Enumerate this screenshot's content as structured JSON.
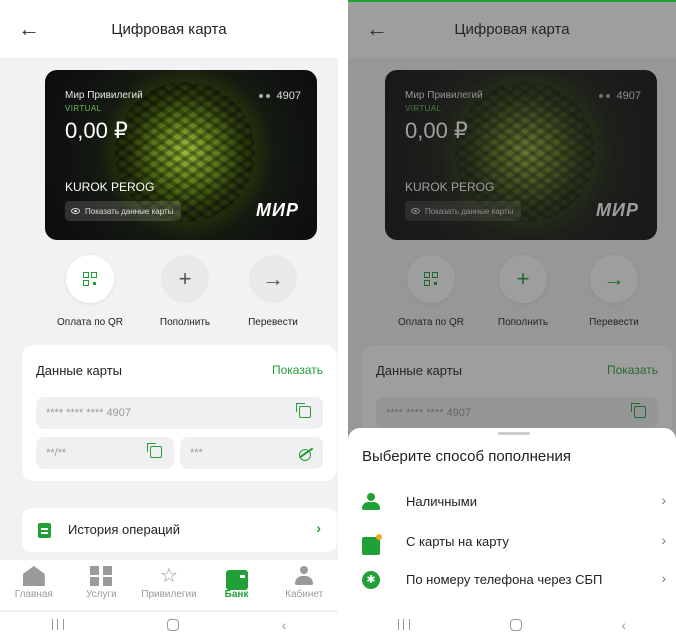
{
  "header": {
    "title": "Цифровая карта"
  },
  "card": {
    "brand": "Мир Привилегий",
    "type": "VIRTUAL",
    "balance": "0,00 ₽",
    "last4": "4907",
    "holder": "KUROK PEROG",
    "show_details": "Показать данные карты",
    "network": "МИР"
  },
  "actions": [
    {
      "label": "Оплата по QR"
    },
    {
      "label": "Пополнить",
      "symbol": "+"
    },
    {
      "label": "Перевести",
      "symbol": "→"
    }
  ],
  "card_data": {
    "title": "Данные карты",
    "show_label": "Показать",
    "number_mask": "**** **** **** 4907",
    "expiry_mask": "**/**",
    "cvv_mask": "***"
  },
  "history": {
    "label": "История операций"
  },
  "tabs": [
    {
      "label": "Главная",
      "icon": "home-icon"
    },
    {
      "label": "Услуги",
      "icon": "grid-icon"
    },
    {
      "label": "Привилегии",
      "icon": "star-icon"
    },
    {
      "label": "Банк",
      "icon": "bank-card-icon",
      "active": true
    },
    {
      "label": "Кабинет",
      "icon": "user-icon"
    }
  ],
  "sheet": {
    "title": "Выберите способ пополнения",
    "options": [
      {
        "label": "Наличными",
        "icon": "cash-person-icon"
      },
      {
        "label": "С карты на карту",
        "icon": "card-to-card-icon"
      },
      {
        "label": "По номеру телефона через СБП",
        "icon": "sbp-icon"
      }
    ]
  },
  "colors": {
    "accent": "#21a038",
    "background": "#f2f2f4"
  }
}
